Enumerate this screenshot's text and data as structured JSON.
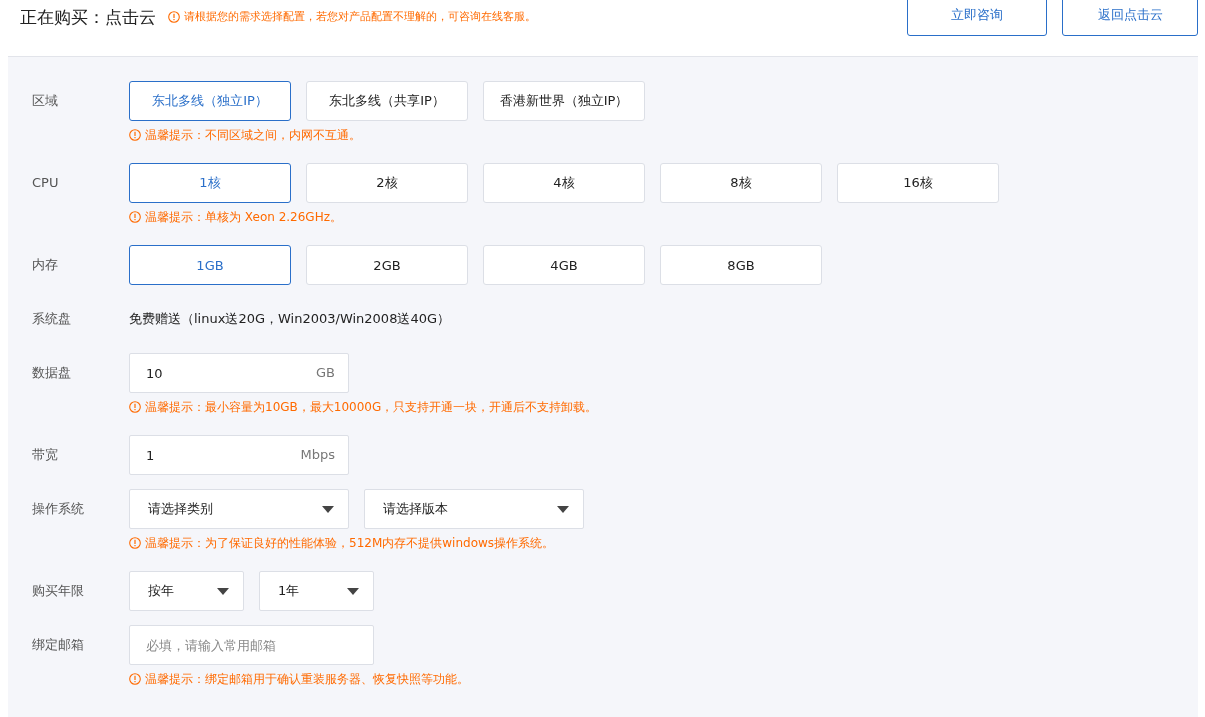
{
  "header": {
    "title": "正在购买：点击云",
    "notice": "请根据您的需求选择配置，若您对产品配置不理解的，可咨询在线客服。",
    "buttons": [
      "立即咨询",
      "返回点击云"
    ]
  },
  "fields": [
    {
      "kind": "options",
      "label": "区域",
      "options": [
        {
          "label": "东北多线（独立IP）",
          "selected": true
        },
        {
          "label": "东北多线（共享IP）",
          "selected": false
        },
        {
          "label": "香港新世界（独立IP）",
          "selected": false
        }
      ],
      "hint": "温馨提示：不同区域之间，内网不互通。"
    },
    {
      "kind": "options",
      "label": "CPU",
      "options": [
        {
          "label": "1核",
          "selected": true
        },
        {
          "label": "2核",
          "selected": false
        },
        {
          "label": "4核",
          "selected": false
        },
        {
          "label": "8核",
          "selected": false
        },
        {
          "label": "16核",
          "selected": false
        }
      ],
      "hint": "温馨提示：单核为 Xeon 2.26GHz。"
    },
    {
      "kind": "options",
      "label": "内存",
      "options": [
        {
          "label": "1GB",
          "selected": true
        },
        {
          "label": "2GB",
          "selected": false
        },
        {
          "label": "4GB",
          "selected": false
        },
        {
          "label": "8GB",
          "selected": false
        }
      ]
    },
    {
      "kind": "text",
      "label": "系统盘",
      "value": "免费赠送（linux送20G，Win2003/Win2008送40G）"
    },
    {
      "kind": "input",
      "label": "数据盘",
      "value": "10",
      "unit": "GB",
      "hint": "温馨提示：最小容量为10GB，最大10000G，只支持开通一块，开通后不支持卸载。"
    },
    {
      "kind": "input",
      "label": "带宽",
      "value": "1",
      "unit": "Mbps"
    },
    {
      "kind": "wide-selects",
      "label": "操作系统",
      "selects": [
        "请选择类别",
        "请选择版本"
      ],
      "hint": "温馨提示：为了保证良好的性能体验，512M内存不提供windows操作系统。"
    },
    {
      "kind": "short-selects",
      "label": "购买年限",
      "selects": [
        "按年",
        "1年"
      ]
    },
    {
      "kind": "input",
      "label": "绑定邮箱",
      "placeholder": "必填，请输入常用邮箱",
      "hint": "温馨提示：绑定邮箱用于确认重装服务器、恢复快照等功能。"
    }
  ]
}
